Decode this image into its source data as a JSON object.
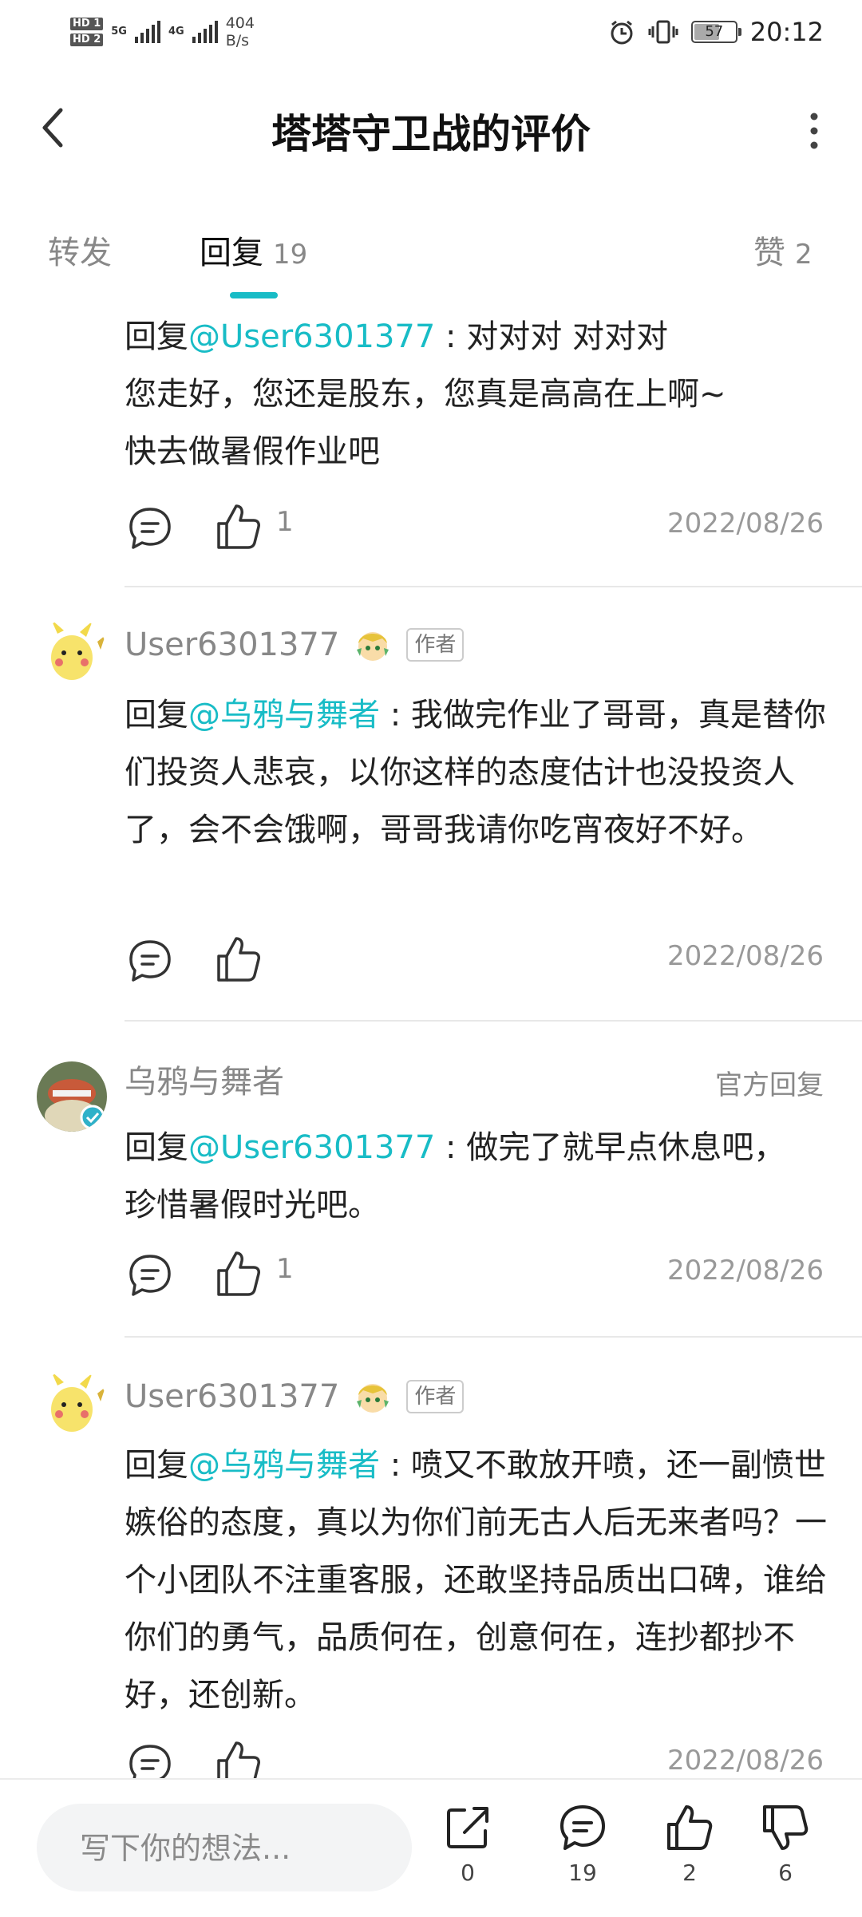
{
  "status_bar": {
    "hd1": "HD 1",
    "hd2": "HD 2",
    "net1": "5G",
    "net2": "4G",
    "speed_value": "404",
    "speed_unit": "B/s",
    "battery": "57",
    "time": "20:12"
  },
  "header": {
    "title": "塔塔守卫战的评价"
  },
  "tabs": [
    {
      "label": "转发",
      "count": ""
    },
    {
      "label": "回复",
      "count": "19"
    },
    {
      "label": "赞",
      "count": "2"
    }
  ],
  "comments": [
    {
      "body_prefix": "回复",
      "mention": "@User6301377",
      "body_rest": " : 对对对 对对对\n您走好，您还是股东，您真是高高在上啊~\n快去做暑假作业吧",
      "likes": "1",
      "date": "2022/08/26"
    },
    {
      "user": "User6301377",
      "author_tag": "作者",
      "body_prefix": "回复",
      "mention": "@乌鸦与舞者",
      "body_rest": " : 我做完作业了哥哥，真是替你们投资人悲哀，以你这样的态度估计也没投资人了，会不会饿啊，哥哥我请你吃宵夜好不好。",
      "likes": "",
      "date": "2022/08/26"
    },
    {
      "user": "乌鸦与舞者",
      "official_label": "官方回复",
      "body_prefix": "回复",
      "mention": "@User6301377",
      "body_rest": " : 做完了就早点休息吧，\n珍惜暑假时光吧。",
      "likes": "1",
      "date": "2022/08/26"
    },
    {
      "user": "User6301377",
      "author_tag": "作者",
      "body_prefix": "回复",
      "mention": "@乌鸦与舞者",
      "body_rest": " : 喷又不敢放开喷，还一副愤世嫉俗的态度，真以为你们前无古人后无来者吗？一个小团队不注重客服，还敢坚持品质出口碑，谁给你们的勇气，品质何在，创意何在，连抄都抄不好，还创新。",
      "date": "2022/08/26"
    }
  ],
  "bottom_bar": {
    "input_placeholder": "写下你的想法...",
    "share_count": "0",
    "comment_count": "19",
    "like_count": "2",
    "dislike_count": "6"
  },
  "colors": {
    "accent": "#18bcc6",
    "text": "#222222",
    "muted": "#888888"
  },
  "icons": [
    "back-arrow-icon",
    "more-vertical-icon",
    "comment-icon",
    "thumbs-up-icon",
    "share-icon",
    "thumbs-down-icon"
  ]
}
